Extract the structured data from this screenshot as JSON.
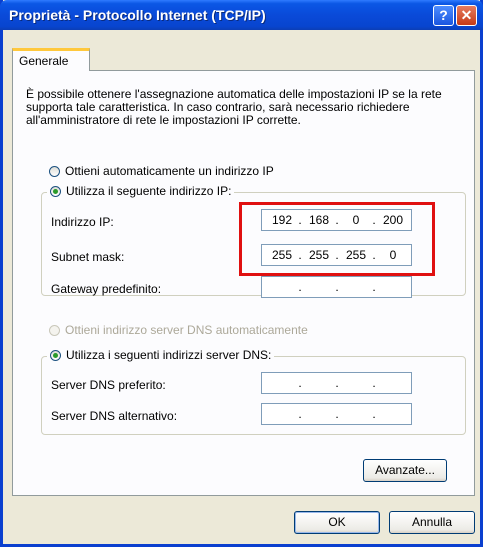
{
  "window": {
    "title": "Proprietà - Protocollo Internet (TCP/IP)",
    "help_glyph": "?",
    "close_glyph": "✕"
  },
  "tab": {
    "label": "Generale"
  },
  "description": "È possibile ottenere l'assegnazione automatica delle impostazioni IP se la rete supporta tale caratteristica. In caso contrario, sarà necessario richiedere all'amministratore di rete le impostazioni IP corrette.",
  "ip_mode": {
    "auto_label": "Ottieni automaticamente un indirizzo IP",
    "manual_label": "Utilizza il seguente indirizzo IP:",
    "selected": "manual"
  },
  "ip_fields": {
    "ip_address": {
      "label": "Indirizzo IP:",
      "octets": [
        "192",
        "168",
        "0",
        "200"
      ]
    },
    "subnet_mask": {
      "label": "Subnet mask:",
      "octets": [
        "255",
        "255",
        "255",
        "0"
      ]
    },
    "gateway": {
      "label": "Gateway predefinito:",
      "octets": [
        "",
        "",
        "",
        ""
      ]
    }
  },
  "dns_mode": {
    "auto_label": "Ottieni indirizzo server DNS automaticamente",
    "manual_label": "Utilizza i seguenti indirizzi server DNS:",
    "selected": "manual"
  },
  "dns_fields": {
    "preferred": {
      "label": "Server DNS preferito:",
      "octets": [
        "",
        "",
        "",
        ""
      ]
    },
    "alternate": {
      "label": "Server DNS alternativo:",
      "octets": [
        "",
        "",
        "",
        ""
      ]
    }
  },
  "buttons": {
    "advanced": "Avanzate...",
    "ok": "OK",
    "cancel": "Annulla"
  },
  "colors": {
    "titlebar": "#0a4ad9",
    "highlight": "#e01010",
    "dialog_bg": "#ece9d8"
  }
}
